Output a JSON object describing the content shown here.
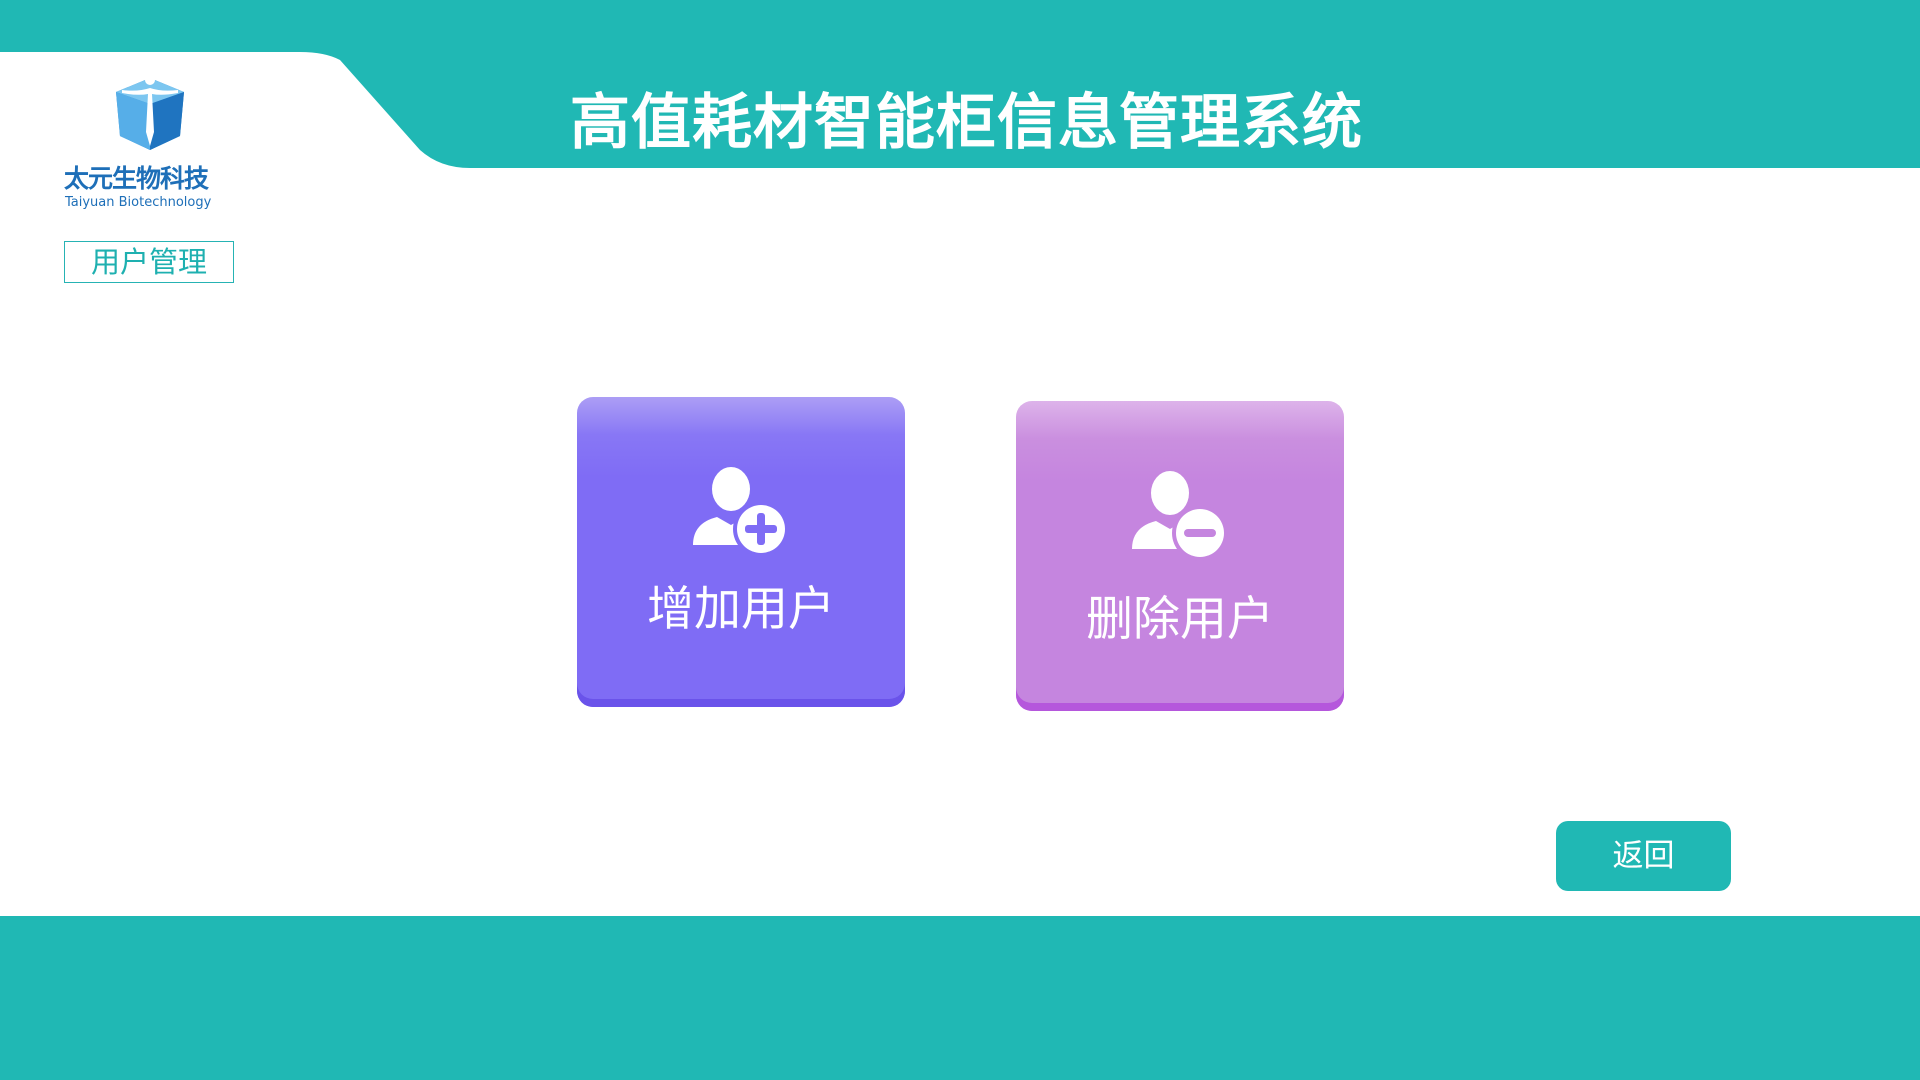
{
  "header": {
    "title": "高值耗材智能柜信息管理系统"
  },
  "logo": {
    "name_cn": "太元生物科技",
    "name_en": "Taiyuan Biotechnology"
  },
  "section": {
    "label": "用户管理"
  },
  "actions": [
    {
      "label": "增加用户",
      "icon": "add-user-icon"
    },
    {
      "label": "删除用户",
      "icon": "remove-user-icon"
    }
  ],
  "back_button": {
    "label": "返回"
  },
  "colors": {
    "primary_teal": "#20b8b4",
    "add_card": "#7f6cf5",
    "remove_card": "#c585df",
    "brand_blue": "#1e6fb8"
  }
}
